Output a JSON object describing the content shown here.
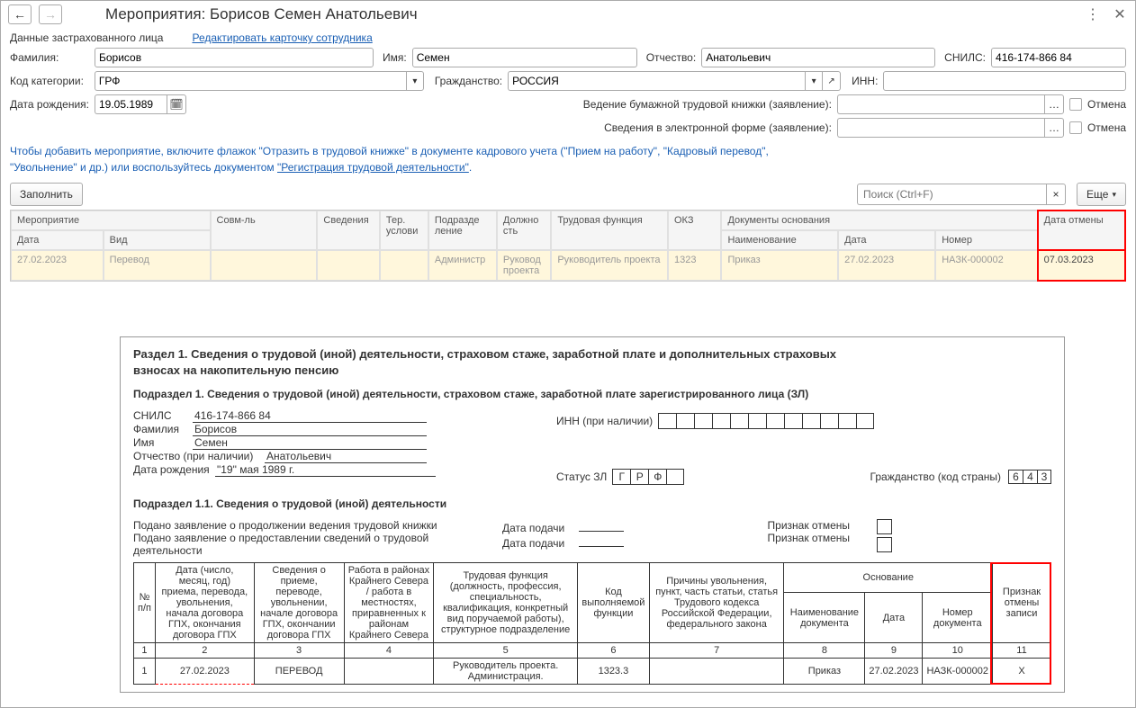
{
  "window": {
    "title": "Мероприятия: Борисов Семен Анатольевич"
  },
  "insured_data_label": "Данные застрахованного лица",
  "edit_card_link": "Редактировать карточку сотрудника",
  "fields": {
    "surname_label": "Фамилия:",
    "surname": "Борисов",
    "name_label": "Имя:",
    "name": "Семен",
    "patronymic_label": "Отчество:",
    "patronymic": "Анатольевич",
    "snils_label": "СНИЛС:",
    "snils": "416-174-866 84",
    "cat_code_label": "Код категории:",
    "cat_code": "ГРФ",
    "citizenship_label": "Гражданство:",
    "citizenship": "РОССИЯ",
    "inn_label": "ИНН:",
    "inn": "",
    "dob_label": "Дата рождения:",
    "dob": "19.05.1989",
    "paper_book_label": "Ведение бумажной трудовой книжки (заявление):",
    "electronic_label": "Сведения в электронной форме (заявление):",
    "cancel_label": "Отмена"
  },
  "hint": {
    "line1": "Чтобы добавить мероприятие, включите флажок \"Отразить в трудовой книжке\" в документе кадрового учета (\"Прием на работу\", \"Кадровый перевод\",",
    "line2_a": "\"Увольнение\" и др.) или воспользуйтесь документом ",
    "line2_link": "\"Регистрация трудовой деятельности\"",
    "line2_b": "."
  },
  "toolbar": {
    "fill": "Заполнить",
    "search_placeholder": "Поиск (Ctrl+F)",
    "more": "Еще"
  },
  "grid": {
    "head": {
      "event": "Мероприятие",
      "date": "Дата",
      "type": "Вид",
      "compat": "Совм-ль",
      "info": "Сведения",
      "ter": "Тер. услови",
      "dept": "Подразде\nление",
      "position": "Должно\nсть",
      "func": "Трудовая функция",
      "okz": "ОКЗ",
      "docs": "Документы основания",
      "docname": "Наименование",
      "docdate": "Дата",
      "docnum": "Номер",
      "cancel": "Дата отмены"
    },
    "row": {
      "date": "27.02.2023",
      "type": "Перевод",
      "dept": "Администр",
      "position": "Руковод\nпроекта",
      "func": "Руководитель проекта",
      "okz": "1323",
      "docname": "Приказ",
      "docdate": "27.02.2023",
      "docnum": "НАЗК-000002",
      "cancel": "07.03.2023"
    }
  },
  "doc": {
    "h1_a": "Раздел 1. Сведения о трудовой (иной) деятельности, страховом стаже, заработной плате и дополнительных страховых",
    "h1_b": "взносах на накопительную пенсию",
    "h2": "Подраздел 1. Сведения о трудовой (иной) деятельности, страховом стаже, заработной плате зарегистрированного лица (ЗЛ)",
    "snils_label": "СНИЛС",
    "snils": "416-174-866 84",
    "inn_label": "ИНН (при наличии)",
    "surname_label": "Фамилия",
    "surname": "Борисов",
    "name_label": "Имя",
    "name": "Семен",
    "patronymic_label": "Отчество (при наличии)",
    "patronymic": "Анатольевич",
    "dob_label": "Дата рождения",
    "dob": "\"19\" мая 1989 г.",
    "status_label": "Статус ЗЛ",
    "status": [
      "Г",
      "Р",
      "Ф"
    ],
    "citizenship_label": "Гражданство (код страны)",
    "citizenship_code": [
      "6",
      "4",
      "3"
    ],
    "sub11": "Подраздел 1.1. Сведения о трудовой (иной) деятельности",
    "stmt1": "Подано заявление о продолжении ведения трудовой книжки",
    "stmt2": "Подано заявление о предоставлении сведений о трудовой деятельности",
    "date_submit": "Дата подачи",
    "cancel_mark": "Признак отмены",
    "dgrid": {
      "h_num": "№\nп/п",
      "h_date": "Дата (число, месяц, год) приема, перевода, увольнения, начала договора ГПХ, окончания договора ГПХ",
      "h_info": "Сведения о приеме, переводе, увольнении, начале договора ГПХ, окончании договора ГПХ",
      "h_north": "Работа в районах Крайнего Севера / работа в местностях, приравненных к районам Крайнего Севера",
      "h_func": "Трудовая функция (должность, профессия, специальность, квалификация, конкретный вид поручаемой работы), структурное подразделение",
      "h_code": "Код выполняемой функции",
      "h_reason": "Причины увольнения, пункт, часть статьи, статья Трудового кодекса Российской Федерации, федерального закона",
      "h_basis": "Основание",
      "h_bname": "Наименование документа",
      "h_bdate": "Дата",
      "h_bnum": "Номер документа",
      "h_cancel": "Признак отмены записи",
      "nums": [
        "1",
        "2",
        "3",
        "4",
        "5",
        "6",
        "7",
        "8",
        "9",
        "10",
        "11"
      ],
      "row": {
        "num": "1",
        "date": "27.02.2023",
        "info": "ПЕРЕВОД",
        "func": "Руководитель проекта. Администрация.",
        "code": "1323.3",
        "bname": "Приказ",
        "bdate": "27.02.2023",
        "bnum": "НАЗК-000002",
        "cancel": "X"
      }
    }
  }
}
